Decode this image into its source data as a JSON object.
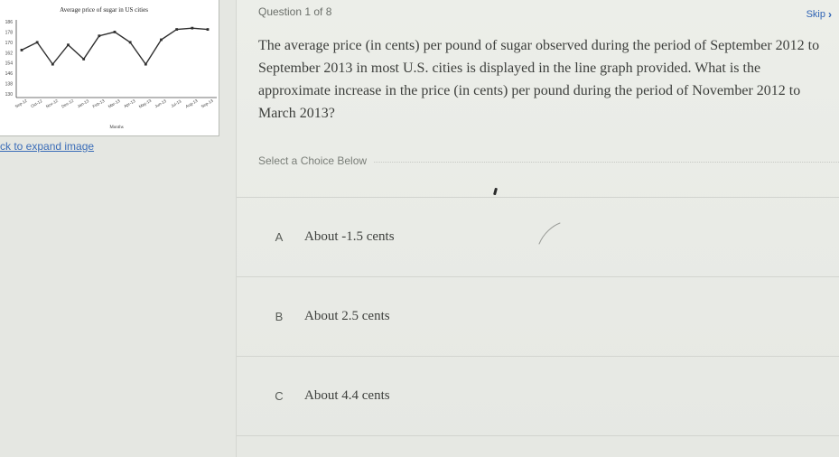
{
  "thumbnail": {
    "expand_link": "ck to expand image"
  },
  "chart_data": {
    "type": "line",
    "title": "Average price of sugar in US cities",
    "xlabel": "Months",
    "ylabel": "",
    "categories": [
      "Sep-12",
      "Oct-12",
      "Nov-12",
      "Dec-12",
      "Jan-13",
      "Feb-13",
      "Mar-13",
      "Apr-13",
      "May-13",
      "Jun-13",
      "Jul-13",
      "Aug-13",
      "Sep-13"
    ],
    "y_ticks": [
      "186",
      "178",
      "170",
      "162",
      "154",
      "146",
      "138",
      "130"
    ],
    "ylim": [
      130,
      186
    ],
    "series": [
      {
        "values": [
          164,
          170,
          153,
          168,
          157,
          175,
          178,
          170,
          153,
          172,
          180,
          181,
          180
        ]
      }
    ],
    "line_color": "#2f2f2f",
    "grid": false
  },
  "question": {
    "counter": "Question 1 of 8",
    "skip_label": "Skip",
    "text": "The average price (in cents) per pound of sugar observed during the period of September 2012 to September 2013 in most U.S. cities is displayed in the line graph provided. What is the approximate increase in the price (in cents) per pound during the period of November 2012 to March 2013?",
    "select_label": "Select a Choice Below",
    "choices": [
      {
        "letter": "A",
        "text": "About -1.5 cents"
      },
      {
        "letter": "B",
        "text": "About 2.5 cents"
      },
      {
        "letter": "C",
        "text": "About 4.4 cents"
      }
    ]
  },
  "colors": {
    "link": "#3b6db8",
    "skip": "#2f64b5",
    "question_text": "#3d3f3c"
  }
}
